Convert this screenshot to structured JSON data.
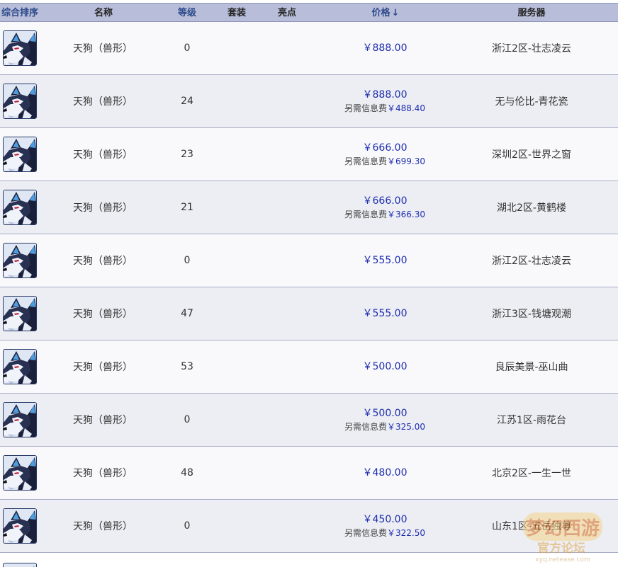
{
  "header": {
    "sort": "综合排序",
    "name": "名称",
    "level": "等级",
    "suit": "套装",
    "highlight": "亮点",
    "price": "价格",
    "price_arrow": "↓",
    "server": "服务器"
  },
  "rows": [
    {
      "name": "天狗（兽形）",
      "level": "0",
      "price": "￥888.00",
      "fee_label": "",
      "fee_amount": "",
      "server": "浙江2区-壮志凌云"
    },
    {
      "name": "天狗（兽形）",
      "level": "24",
      "price": "￥888.00",
      "fee_label": "另需信息费",
      "fee_amount": "￥488.40",
      "server": "无与伦比-青花瓷"
    },
    {
      "name": "天狗（兽形）",
      "level": "23",
      "price": "￥666.00",
      "fee_label": "另需信息费",
      "fee_amount": "￥699.30",
      "server": "深圳2区-世界之窗"
    },
    {
      "name": "天狗（兽形）",
      "level": "21",
      "price": "￥666.00",
      "fee_label": "另需信息费",
      "fee_amount": "￥366.30",
      "server": "湖北2区-黄鹤楼"
    },
    {
      "name": "天狗（兽形）",
      "level": "0",
      "price": "￥555.00",
      "fee_label": "",
      "fee_amount": "",
      "server": "浙江2区-壮志凌云"
    },
    {
      "name": "天狗（兽形）",
      "level": "47",
      "price": "￥555.00",
      "fee_label": "",
      "fee_amount": "",
      "server": "浙江3区-钱塘观潮"
    },
    {
      "name": "天狗（兽形）",
      "level": "53",
      "price": "￥500.00",
      "fee_label": "",
      "fee_amount": "",
      "server": "良辰美景-巫山曲"
    },
    {
      "name": "天狗（兽形）",
      "level": "0",
      "price": "￥500.00",
      "fee_label": "另需信息费",
      "fee_amount": "￥325.00",
      "server": "江苏1区-雨花台"
    },
    {
      "name": "天狗（兽形）",
      "level": "48",
      "price": "￥480.00",
      "fee_label": "",
      "fee_amount": "",
      "server": "北京2区-一生一世"
    },
    {
      "name": "天狗（兽形）",
      "level": "0",
      "price": "￥450.00",
      "fee_label": "另需信息费",
      "fee_amount": "￥322.50",
      "server": "山东1区-五岳独尊"
    }
  ],
  "watermark": {
    "title": "梦幻西游",
    "subtitle": "官方论坛",
    "url": "xyq.netease.com"
  },
  "colors": {
    "header_bg": "#b8bdd9",
    "price": "#1d2db0",
    "row_odd": "#f9f9fb",
    "row_even": "#edeef3"
  },
  "icons": {
    "avatar": "husky-pet-avatar-icon",
    "sort_arrow": "arrow-down-icon"
  }
}
